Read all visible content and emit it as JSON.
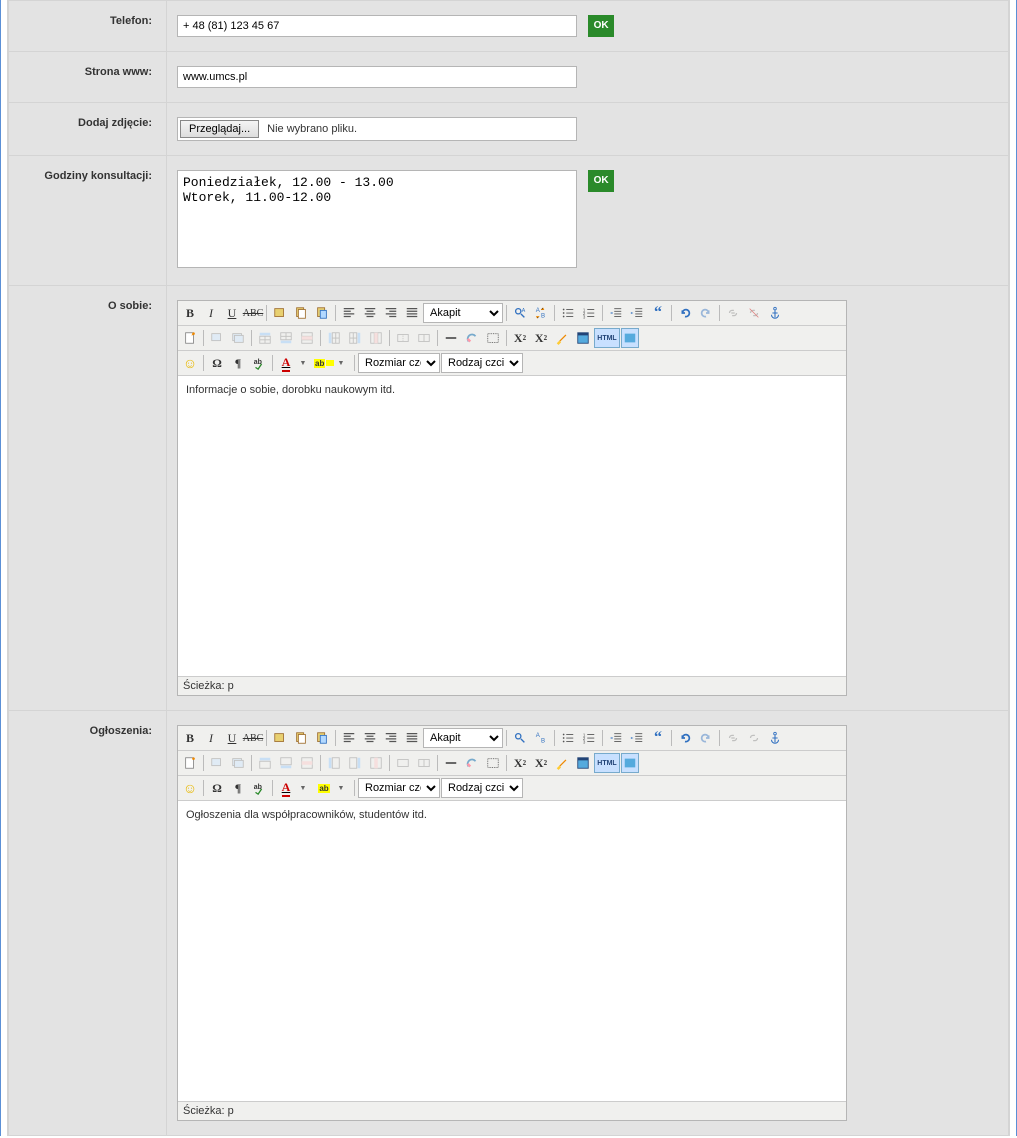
{
  "labels": {
    "telefon": "Telefon:",
    "strona": "Strona www:",
    "dodaj_zdjecie": "Dodaj zdjęcie:",
    "godziny": "Godziny konsultacji:",
    "o_sobie": "O sobie:",
    "ogloszenia": "Ogłoszenia:"
  },
  "values": {
    "telefon": "+ 48 (81) 123 45 67",
    "strona": "www.umcs.pl",
    "file_btn": "Przeglądaj...",
    "file_status": "Nie wybrano pliku.",
    "godziny": "Poniedziałek, 12.00 - 13.00\nWtorek, 11.00-12.00",
    "o_sobie_content": "Informacje o sobie, dorobku naukowym itd.",
    "ogloszenia_content": "Ogłoszenia dla współpracowników, studentów itd."
  },
  "buttons": {
    "ok": "OK"
  },
  "editor": {
    "format": "Akapit",
    "font_size": "Rozmiar czcion",
    "font_family": "Rodzaj czcionk",
    "path_label": "Ścieżka: p",
    "html_label": "HTML"
  }
}
